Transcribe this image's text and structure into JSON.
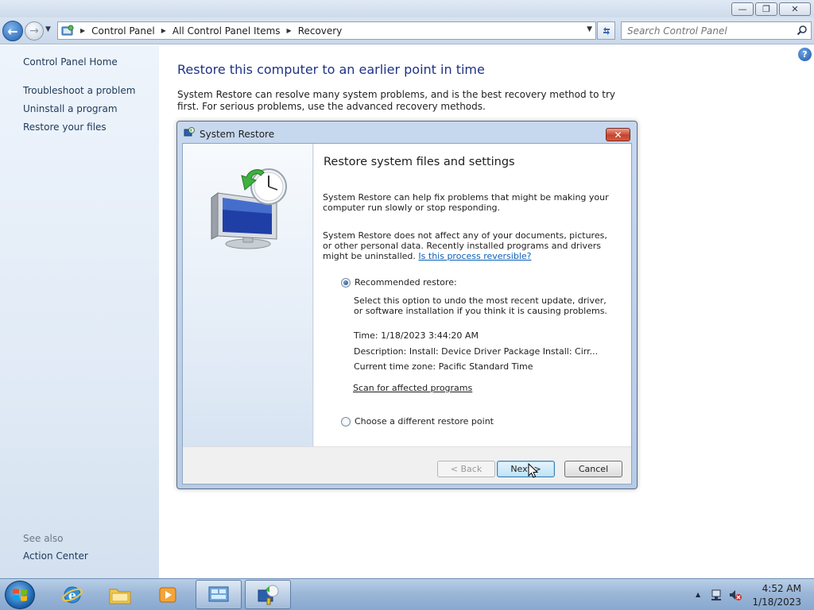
{
  "window": {
    "minimize_glyph": "—",
    "maximize_glyph": "❐",
    "close_glyph": "✕"
  },
  "nav": {
    "back_glyph": "←",
    "forward_glyph": "→",
    "recent_glyph": "▼",
    "breadcrumbs": [
      "Control Panel",
      "All Control Panel Items",
      "Recovery"
    ],
    "search_placeholder": "Search Control Panel"
  },
  "left_pane": {
    "home": "Control Panel Home",
    "links": [
      "Troubleshoot a problem",
      "Uninstall a program",
      "Restore your files"
    ],
    "see_also_label": "See also",
    "see_also_links": [
      "Action Center"
    ]
  },
  "main": {
    "title": "Restore this computer to an earlier point in time",
    "description": "System Restore can resolve many system problems, and is the best recovery method to try first. For serious problems, use the advanced recovery methods."
  },
  "dialog": {
    "title": "System Restore",
    "heading": "Restore system files and settings",
    "para1": "System Restore can help fix problems that might be making your computer run slowly or stop responding.",
    "para2": "System Restore does not affect any of your documents, pictures, or other personal data. Recently installed programs and drivers might be uninstalled.",
    "reversible_link": "Is this process reversible?",
    "option_recommended": "Recommended restore:",
    "recommended_desc": "Select this option to undo the most recent update, driver, or software installation if you think it is causing problems.",
    "time": "Time: 1/18/2023 3:44:20 AM",
    "description": "Description: Install: Device Driver Package Install: Cirr...",
    "timezone": "Current time zone: Pacific Standard Time",
    "scan_link": "Scan for affected programs",
    "option_different": "Choose a different restore point",
    "recommended_selected": true,
    "back_button": "< Back",
    "next_button": "Next >",
    "cancel_button": "Cancel"
  },
  "taskbar": {
    "clock_time": "4:52 AM",
    "clock_date": "1/18/2023",
    "tray_arrow": "▲"
  },
  "colors": {
    "title_blue": "#1e3287",
    "link_blue": "#0b5fb6",
    "left_pane_link": "#1e395b"
  }
}
